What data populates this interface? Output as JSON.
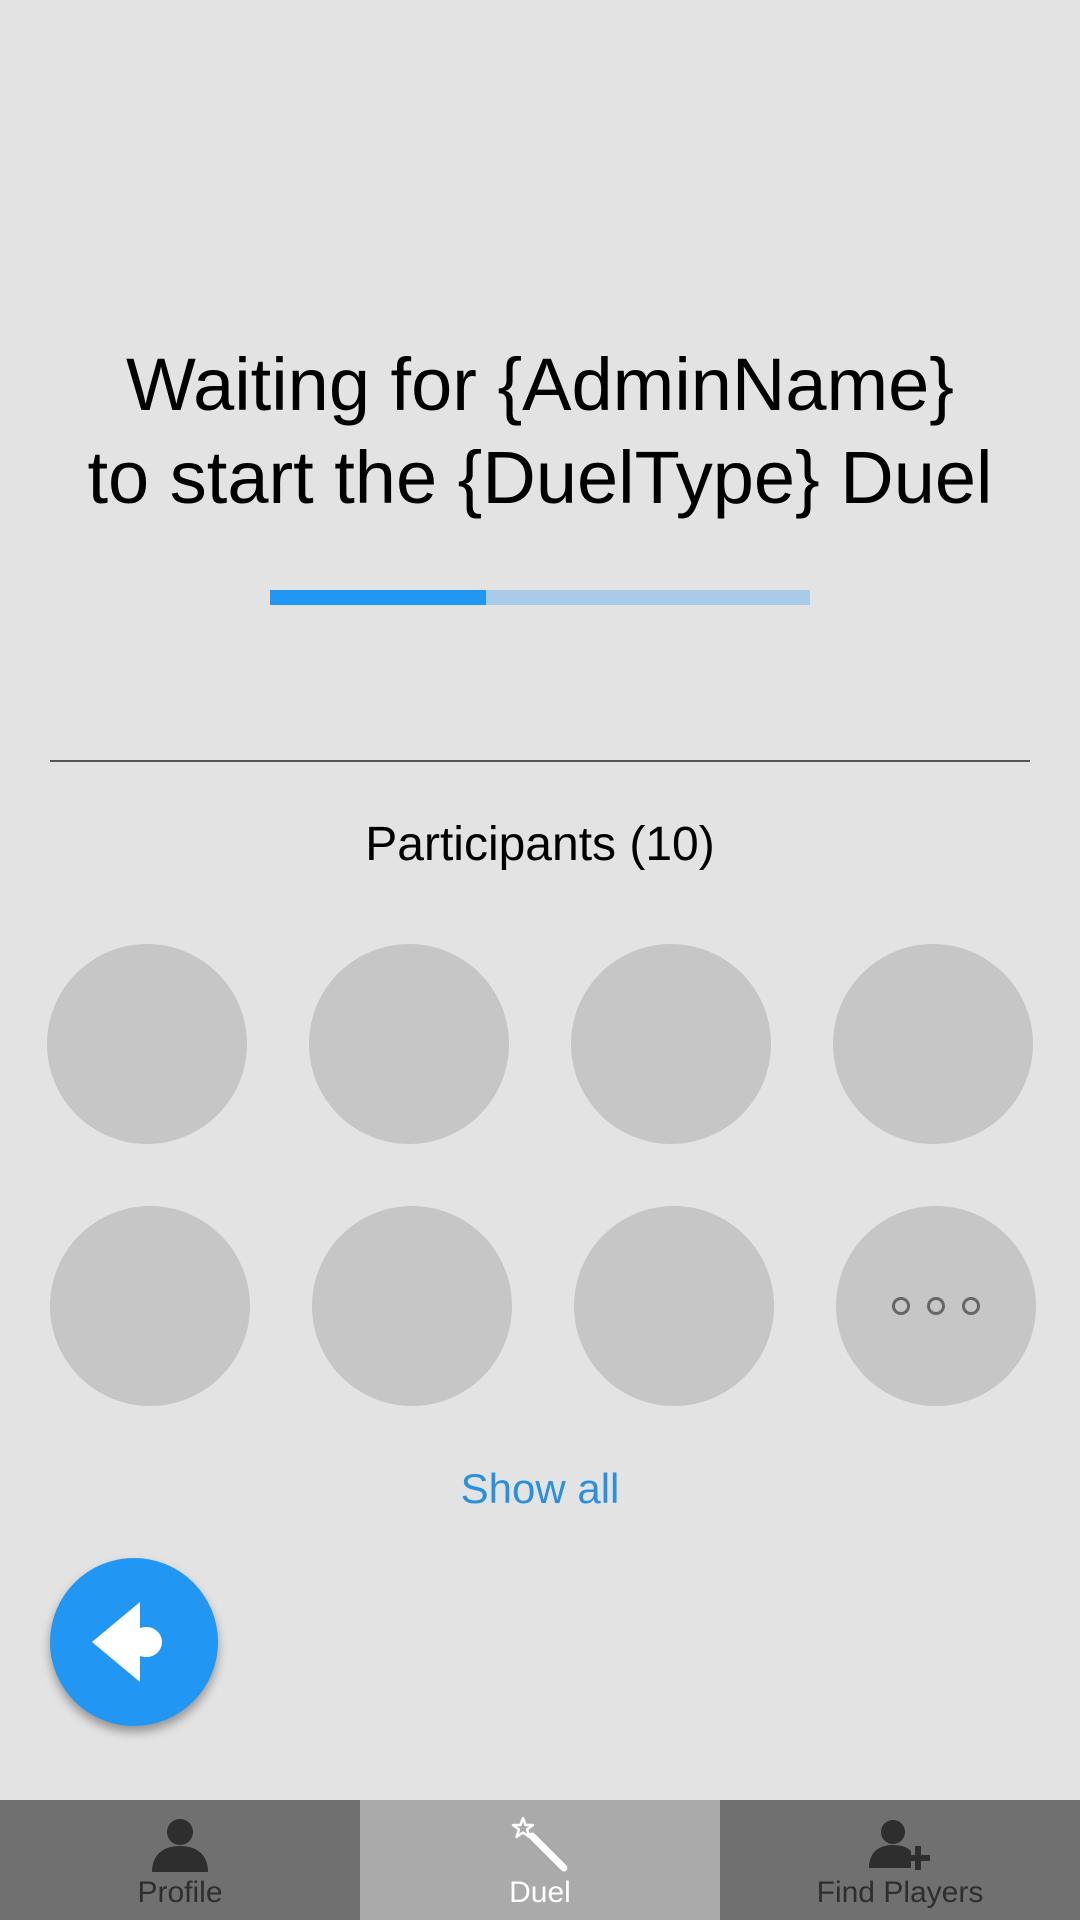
{
  "waiting": {
    "line1": "Waiting for {AdminName}",
    "line2": "to start the {DuelType} Duel"
  },
  "progress": {
    "fraction": 0.4,
    "fill_color": "#2196f3",
    "track_color": "#a7cbe9"
  },
  "participants": {
    "heading": "Participants (10)",
    "visible_avatars": 7,
    "more_icon": "more-dots-icon",
    "show_all_label": "Show all"
  },
  "fab": {
    "icon": "back-arrow-icon",
    "color": "#2196f3"
  },
  "tabs": [
    {
      "label": "Profile",
      "icon": "person-icon",
      "active": false
    },
    {
      "label": "Duel",
      "icon": "magic-wand-icon",
      "active": true
    },
    {
      "label": "Find Players",
      "icon": "add-person-icon",
      "active": false
    }
  ],
  "colors": {
    "background": "#e3e3e3",
    "avatar_placeholder": "#c6c6c6",
    "link": "#2a8fdc",
    "tab_inactive": "#707070",
    "tab_active": "#aaaaaa"
  }
}
